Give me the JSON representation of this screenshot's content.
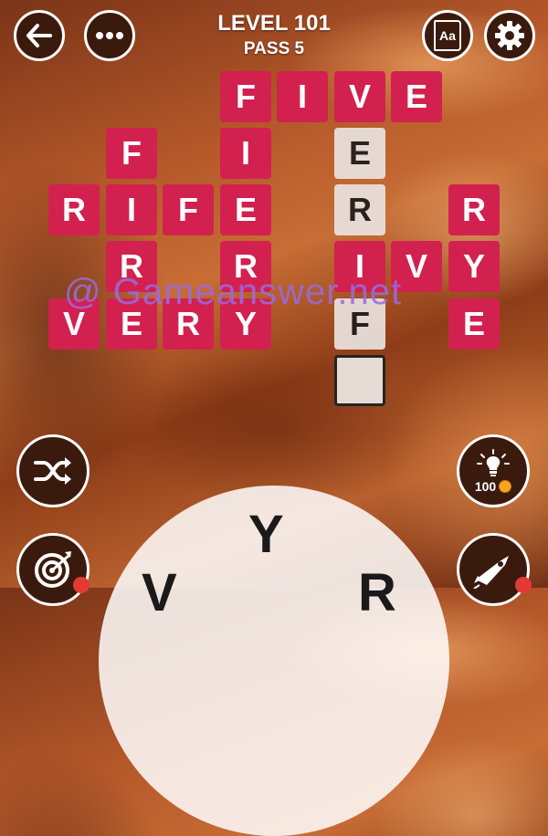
{
  "header": {
    "level": "LEVEL 101",
    "pass": "PASS 5"
  },
  "buttons": {
    "back_icon": "back-arrow-icon",
    "menu_icon": "more-dots-icon",
    "dictionary_label": "Aa",
    "settings_icon": "gear-icon",
    "shuffle_icon": "shuffle-icon",
    "hint_cost": "100",
    "target_icon": "target-icon",
    "rocket_icon": "rocket-icon"
  },
  "tiles": {
    "five": [
      "F",
      "I",
      "V",
      "E"
    ],
    "col2": [
      "F",
      "I",
      "R",
      "E",
      "V"
    ],
    "col4": [
      "I",
      "E",
      "R",
      "Y"
    ],
    "rife": [
      "R",
      "I",
      "F",
      "E"
    ],
    "very": [
      "V",
      "E",
      "R",
      "Y"
    ],
    "fier_col": [
      "E",
      "R",
      "I",
      "F"
    ],
    "ivy": [
      "V",
      "Y"
    ],
    "rye": [
      "R",
      "E"
    ]
  },
  "watermark": "@ Gameanswer.net",
  "wheel": {
    "letters": [
      "Y",
      "V",
      "R"
    ]
  },
  "colors": {
    "tile": "#d2214f",
    "hint_tile": "#e9e2de",
    "button_bg": "#3b1a0e"
  }
}
